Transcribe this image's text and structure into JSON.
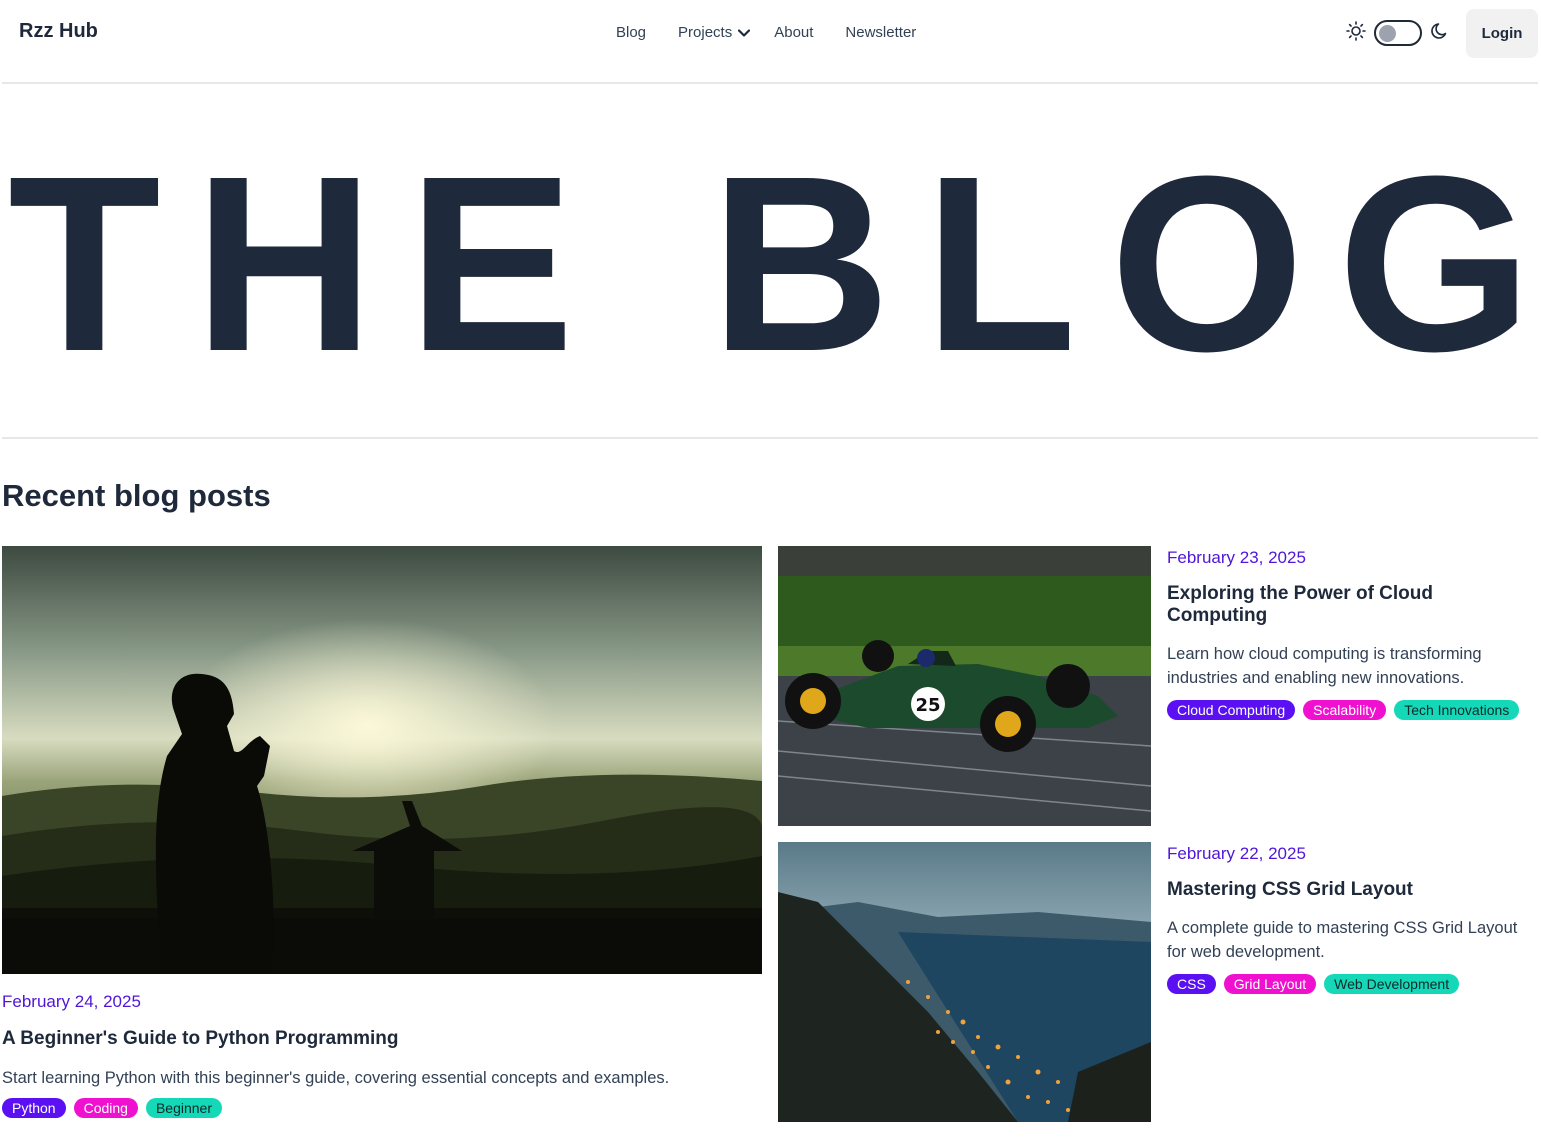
{
  "brand": "Rzz Hub",
  "nav": {
    "blog": "Blog",
    "projects": "Projects",
    "about": "About",
    "newsletter": "Newsletter"
  },
  "login": "Login",
  "hero": {
    "title": "THE BLOG"
  },
  "section_title": "Recent blog posts",
  "colors": {
    "date": "#4f16d8",
    "tag_primary": "#5b10f3",
    "tag_secondary": "#f010d0",
    "tag_tertiary": "#14d8b8"
  },
  "posts": [
    {
      "date": "February 24, 2025",
      "title": "A Beginner's Guide to Python Programming",
      "description": "Start learning Python with this beginner's guide, covering essential concepts and examples.",
      "tags": [
        "Python",
        "Coding",
        "Beginner"
      ]
    },
    {
      "date": "February 23, 2025",
      "title": "Exploring the Power of Cloud Computing",
      "description": "Learn how cloud computing is transforming industries and enabling new innovations.",
      "tags": [
        "Cloud Computing",
        "Scalability",
        "Tech Innovations"
      ]
    },
    {
      "date": "February 22, 2025",
      "title": "Mastering CSS Grid Layout",
      "description": "A complete guide to mastering CSS Grid Layout for web development.",
      "tags": [
        "CSS",
        "Grid Layout",
        "Web Development"
      ]
    }
  ]
}
